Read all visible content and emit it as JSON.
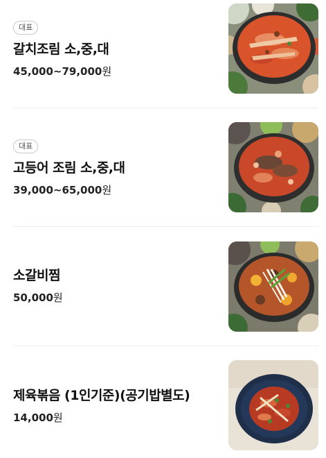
{
  "menu": {
    "items": [
      {
        "badge": "대표",
        "name": "갈치조림 소,중,대",
        "price": "45,000~79,000",
        "unit": "원",
        "image_icon": "braised-cutlassfish-photo"
      },
      {
        "badge": "대표",
        "name": "고등어 조림 소,중,대",
        "price": "39,000~65,000",
        "unit": "원",
        "image_icon": "braised-mackerel-photo"
      },
      {
        "name": "소갈비찜",
        "price": "50,000",
        "unit": "원",
        "image_icon": "braised-short-ribs-photo"
      },
      {
        "name": "제육볶음 (1인기준)(공기밥별도)",
        "price": "14,000",
        "unit": "원",
        "image_icon": "spicy-pork-stir-fry-photo"
      }
    ]
  },
  "colors": {
    "text": "#111111",
    "badge_border": "#c9c9c9",
    "divider": "#efefef",
    "stew_red": "#d9532b"
  }
}
